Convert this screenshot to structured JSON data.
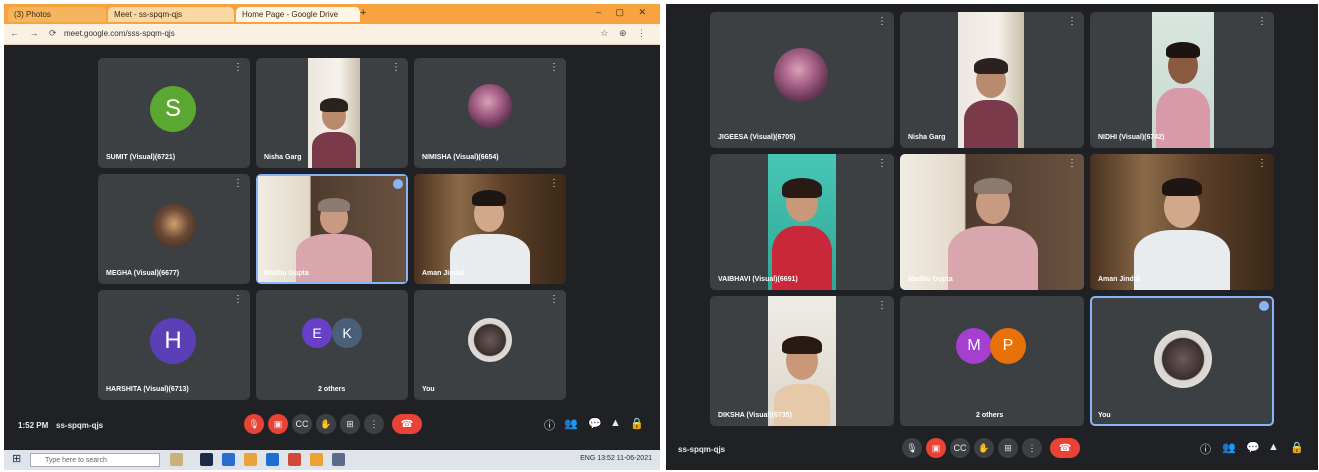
{
  "browser": {
    "tabs": [
      "(3) Photos",
      "Meet - ss-spqm-qjs",
      "Home Page - Google Drive"
    ],
    "new_tab": "+",
    "url": "meet.google.com/sss-spqm-qjs",
    "window_controls": "– ▢ ✕",
    "nav": "← → ⟳",
    "addr_icons": "☆ ⊕ ⋮"
  },
  "left": {
    "tiles": [
      {
        "name": "SUMIT (Visual)(6721)",
        "avatar_letter": "S",
        "avatar_color": "#5aa832"
      },
      {
        "name": "Nisha Garg"
      },
      {
        "name": "NIMISHA (Visual)(6654)"
      },
      {
        "name": "MEGHA (Visual)(6677)"
      },
      {
        "name": "Madhu Gupta"
      },
      {
        "name": "Aman Jindal"
      },
      {
        "name": "HARSHITA (Visual)(6713)",
        "avatar_letter": "H",
        "avatar_color": "#5a3fb6"
      },
      {
        "name": "2 others",
        "avatar_letters": [
          "E",
          "K"
        ],
        "avatar_colors": [
          "#6a3fc8",
          "#4a6078"
        ]
      },
      {
        "name": "You"
      }
    ],
    "meeting_time": "1:52 PM",
    "meeting_code": "ss-spqm-qjs",
    "more_icon": "⋮"
  },
  "right": {
    "tiles": [
      {
        "name": "JIGEESA (Visual)(6705)"
      },
      {
        "name": "Nisha Garg"
      },
      {
        "name": "NIDHI (Visual)(6742)"
      },
      {
        "name": "VAIBHAVI (Visual)(6691)"
      },
      {
        "name": "Madhu Gupta"
      },
      {
        "name": "Aman Jindal"
      },
      {
        "name": "DIKSHA (Visual)(6735)"
      },
      {
        "name": "2 others",
        "avatar_letters": [
          "M",
          "P"
        ],
        "avatar_colors": [
          "#a43fd0",
          "#e8710a"
        ]
      },
      {
        "name": "You"
      }
    ],
    "meeting_code": "ss-spqm-qjs",
    "more_icon": "⋮"
  },
  "controls": {
    "mic": "🎙",
    "cam": "▣",
    "captions": "CC",
    "raise_hand": "✋",
    "present": "⊞",
    "more": "⋮",
    "end": "☎",
    "info": "ⓘ",
    "people": "👥",
    "chat": "💬",
    "activities": "▲",
    "lock": "🔒"
  },
  "taskbar": {
    "start": "⊞",
    "search_placeholder": "Type here to search",
    "tray": "ENG  13:52  11-06-2021"
  },
  "colors": {
    "meet_bg": "#202124",
    "tile_bg": "#3c4043",
    "end_call": "#ea4335",
    "speaking_border": "#8ab4f8",
    "browser_accent": "#f7a340"
  }
}
